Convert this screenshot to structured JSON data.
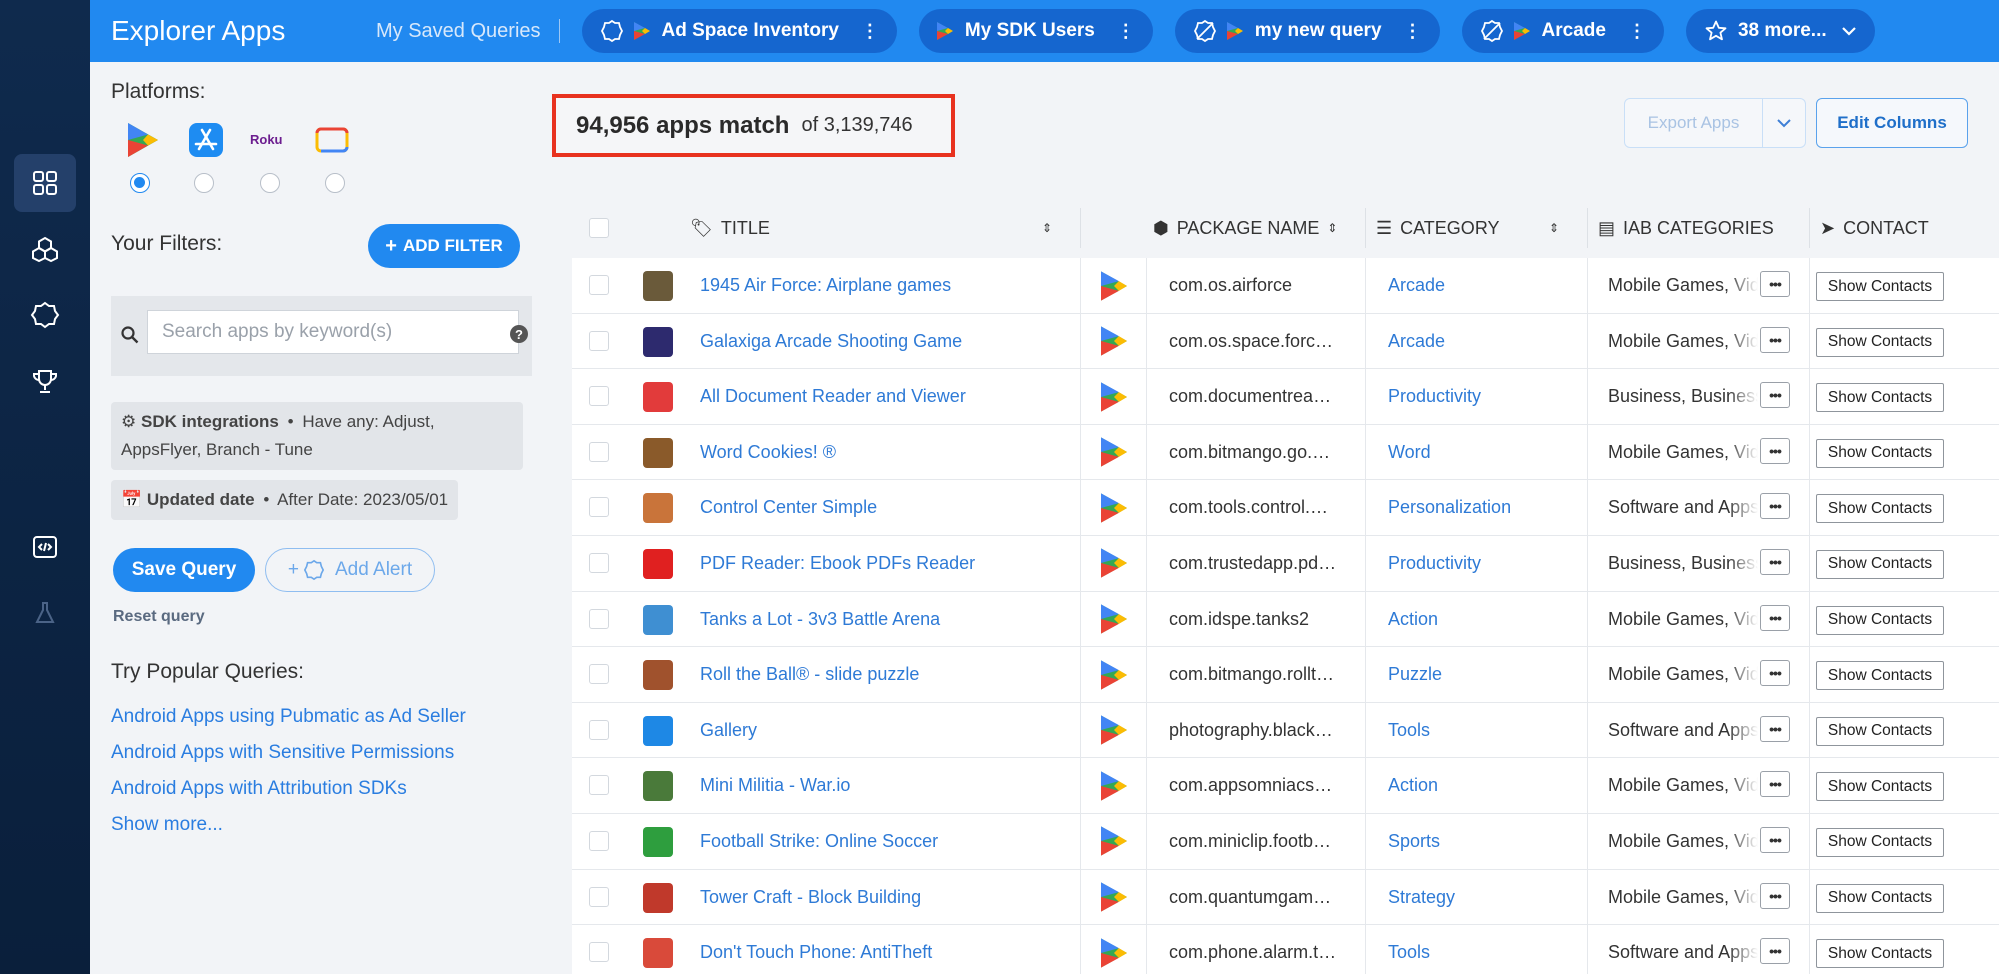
{
  "app": {
    "title": "Explorer Apps"
  },
  "topbar": {
    "saved_label": "My Saved Queries",
    "tabs": [
      {
        "label": "Ad Space Inventory",
        "icon": "alert-off-icon"
      },
      {
        "label": "My SDK Users",
        "icon": ""
      },
      {
        "label": "my new query",
        "icon": "alert-disabled-icon"
      },
      {
        "label": "Arcade",
        "icon": "alert-disabled-icon"
      }
    ],
    "more_label": "38 more..."
  },
  "sidebar": {
    "platforms_label": "Platforms:",
    "platforms": [
      "google-play",
      "app-store",
      "roku",
      "google-tv"
    ],
    "selected_platform": "google-play",
    "filters_label": "Your Filters:",
    "add_filter_label": "ADD FILTER",
    "search_placeholder": "Search apps by keyword(s)",
    "filter_chips": [
      {
        "bold": "SDK integrations",
        "sep": "•",
        "text": "Have any: Adjust,",
        "text2": "AppsFlyer, Branch - Tune"
      },
      {
        "bold": "Updated date",
        "sep": "•",
        "text": "After Date: 2023/05/01"
      }
    ],
    "save_query_label": "Save Query",
    "add_alert_label": "Add Alert",
    "reset_label": "Reset query",
    "popular_label": "Try Popular Queries:",
    "popular": [
      "Android Apps using Pubmatic as Ad Seller",
      "Android Apps with Sensitive Permissions",
      "Android Apps with Attribution SDKs",
      "Show more..."
    ]
  },
  "results": {
    "count": "94,956 apps match",
    "total": "of 3,139,746",
    "export_label": "Export Apps",
    "edit_columns_label": "Edit Columns"
  },
  "table": {
    "headers": {
      "title": "TITLE",
      "package": "PACKAGE NAME",
      "category": "CATEGORY",
      "iab": "IAB CATEGORIES",
      "contact": "CONTACT"
    },
    "contact_button": "Show Contacts",
    "more_button": "•••",
    "rows": [
      {
        "title": "1945 Air Force: Airplane games",
        "package": "com.os.airforce",
        "category": "Arcade",
        "iab": "Mobile Games, Video",
        "icon_color": "#6a5a3a"
      },
      {
        "title": "Galaxiga Arcade Shooting Game",
        "package": "com.os.space.forc…",
        "category": "Arcade",
        "iab": "Mobile Games, Video",
        "icon_color": "#2d2a6e"
      },
      {
        "title": "All Document Reader and Viewer",
        "package": "com.documentrea…",
        "category": "Productivity",
        "iab": "Business, Business",
        "icon_color": "#e23b3b"
      },
      {
        "title": "Word Cookies! ®",
        "package": "com.bitmango.go.…",
        "category": "Word",
        "iab": "Mobile Games, Video",
        "icon_color": "#8a5a2a"
      },
      {
        "title": "Control Center Simple",
        "package": "com.tools.control.…",
        "category": "Personalization",
        "iab": "Software and Apps",
        "icon_color": "#c9743a"
      },
      {
        "title": "PDF Reader: Ebook PDFs Reader",
        "package": "com.trustedapp.pd…",
        "category": "Productivity",
        "iab": "Business, Business",
        "icon_color": "#e02020"
      },
      {
        "title": "Tanks a Lot - 3v3 Battle Arena",
        "package": "com.idspe.tanks2",
        "category": "Action",
        "iab": "Mobile Games, Video",
        "icon_color": "#3f8fd2"
      },
      {
        "title": "Roll the Ball® - slide puzzle",
        "package": "com.bitmango.rollt…",
        "category": "Puzzle",
        "iab": "Mobile Games, Video",
        "icon_color": "#a0522d"
      },
      {
        "title": "Gallery",
        "package": "photography.black…",
        "category": "Tools",
        "iab": "Software and Apps",
        "icon_color": "#1e88e5"
      },
      {
        "title": "Mini Militia - War.io",
        "package": "com.appsomniacs…",
        "category": "Action",
        "iab": "Mobile Games, Video",
        "icon_color": "#4a7a3a"
      },
      {
        "title": "Football Strike: Online Soccer",
        "package": "com.miniclip.footb…",
        "category": "Sports",
        "iab": "Mobile Games, Video",
        "icon_color": "#2e9e3e"
      },
      {
        "title": "Tower Craft - Block Building",
        "package": "com.quantumgam…",
        "category": "Strategy",
        "iab": "Mobile Games, Video",
        "icon_color": "#c0392b"
      },
      {
        "title": "Don't Touch Phone: AntiTheft",
        "package": "com.phone.alarm.t…",
        "category": "Tools",
        "iab": "Software and Apps",
        "icon_color": "#d94a3a"
      }
    ]
  }
}
